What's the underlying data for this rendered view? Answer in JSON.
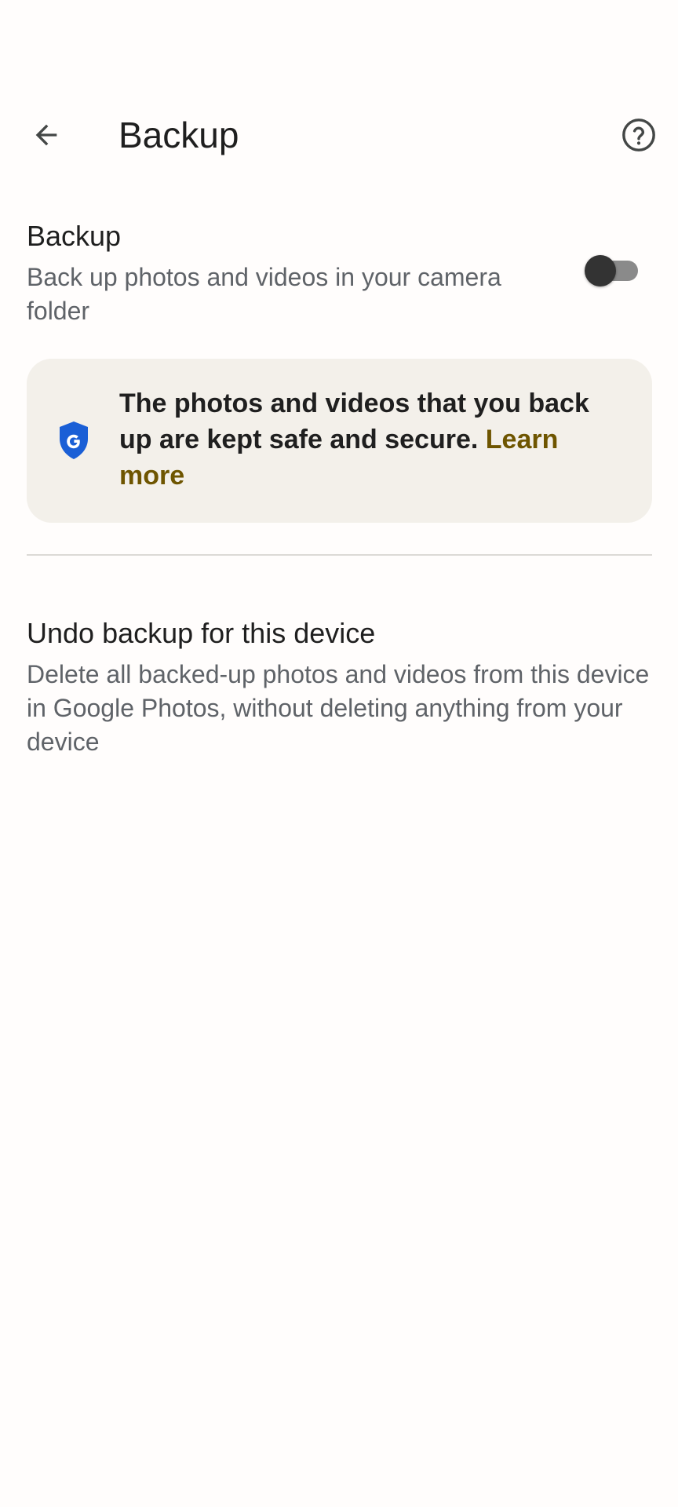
{
  "header": {
    "title": "Backup",
    "back_icon": "arrow-back-icon",
    "help_icon": "help-circle-icon"
  },
  "backup_setting": {
    "title": "Backup",
    "description": "Back up photos and videos in your camera folder",
    "toggle_state": "off"
  },
  "info_card": {
    "icon": "google-shield-icon",
    "text": "The photos and videos that you back up are kept safe and secure. ",
    "link_text": "Learn more"
  },
  "undo_backup": {
    "title": "Undo backup for this device",
    "description": "Delete all backed-up photos and videos from this device in Google Photos, without deleting anything from your device"
  },
  "colors": {
    "background": "#fffdfc",
    "card_background": "#f3f0ea",
    "link": "#6e5500",
    "shield_blue": "#1a5fd6",
    "secondary_text": "#5f6368"
  }
}
